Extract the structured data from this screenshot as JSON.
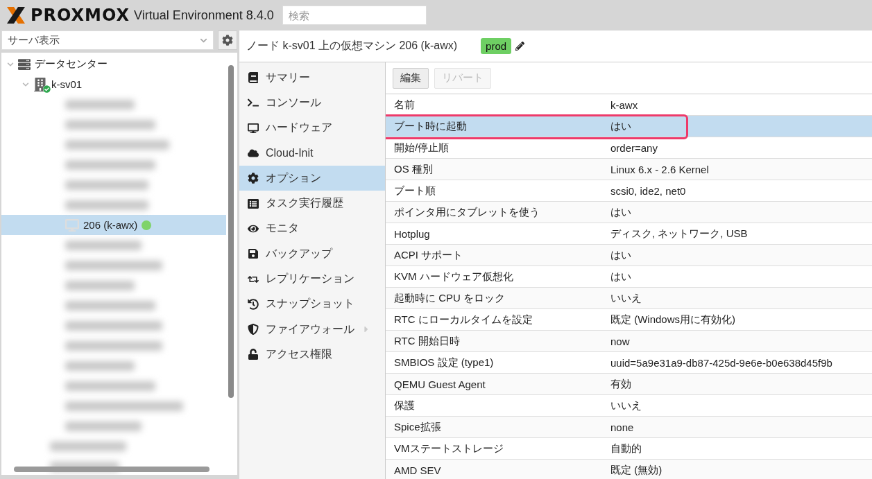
{
  "header": {
    "logo": "PROXMOX",
    "product": "Virtual Environment 8.4.0",
    "search": {
      "placeholder": "検索"
    }
  },
  "view_selector": {
    "value": "サーバ表示"
  },
  "tree": [
    {
      "kind": "datacenter",
      "label": "データセンター",
      "expanded": true,
      "children": [
        {
          "kind": "node",
          "label": "k-sv01",
          "expanded": true,
          "children": [
            {
              "kind": "blurred"
            },
            {
              "kind": "blurred"
            },
            {
              "kind": "blurred"
            },
            {
              "kind": "blurred"
            },
            {
              "kind": "blurred"
            },
            {
              "kind": "blurred"
            },
            {
              "kind": "vm",
              "label": "206 (k-awx)",
              "selected": true,
              "color": "#7fd36a"
            },
            {
              "kind": "blurred"
            },
            {
              "kind": "blurred"
            },
            {
              "kind": "blurred"
            },
            {
              "kind": "blurred"
            },
            {
              "kind": "blurred"
            },
            {
              "kind": "blurred"
            },
            {
              "kind": "blurred"
            },
            {
              "kind": "blurred"
            },
            {
              "kind": "blurred"
            },
            {
              "kind": "blurred"
            }
          ]
        },
        {
          "kind": "blurred"
        },
        {
          "kind": "blurred"
        }
      ]
    }
  ],
  "title": {
    "text_before": "ノード ",
    "node": "k-sv01",
    "text_middle": " 上の仮想マシン ",
    "vm": "206 (k-awx)",
    "tag": "prod"
  },
  "nav": [
    {
      "label": "サマリー",
      "selected": false
    },
    {
      "label": "コンソール",
      "selected": false
    },
    {
      "label": "ハードウェア",
      "selected": false
    },
    {
      "label": "Cloud-Init",
      "selected": false
    },
    {
      "label": "オプション",
      "selected": true
    },
    {
      "label": "タスク実行履歴",
      "selected": false
    },
    {
      "label": "モニタ",
      "selected": false
    },
    {
      "label": "バックアップ",
      "selected": false
    },
    {
      "label": "レプリケーション",
      "selected": false
    },
    {
      "label": "スナップショット",
      "selected": false
    },
    {
      "label": "ファイアウォール",
      "selected": false,
      "has_submenu": true
    },
    {
      "label": "アクセス権限",
      "selected": false
    }
  ],
  "toolbar": [
    {
      "label": "編集",
      "disabled": false
    },
    {
      "label": "リバート",
      "disabled": true
    }
  ],
  "options": [
    {
      "name": "名前",
      "value": "k-awx",
      "selected": false
    },
    {
      "name": "ブート時に起動",
      "value": "はい",
      "selected": true,
      "annotated": true
    },
    {
      "name": "開始/停止順",
      "value": "order=any",
      "selected": false
    },
    {
      "name": "OS 種別",
      "value": "Linux 6.x - 2.6 Kernel",
      "selected": false
    },
    {
      "name": "ブート順",
      "value": "scsi0, ide2, net0",
      "selected": false
    },
    {
      "name": "ポインタ用にタブレットを使う",
      "value": "はい",
      "selected": false
    },
    {
      "name": "Hotplug",
      "value": "ディスク, ネットワーク, USB",
      "selected": false
    },
    {
      "name": "ACPI サポート",
      "value": "はい",
      "selected": false
    },
    {
      "name": "KVM ハードウェア仮想化",
      "value": "はい",
      "selected": false
    },
    {
      "name": "起動時に CPU をロック",
      "value": "いいえ",
      "selected": false
    },
    {
      "name": "RTC にローカルタイムを設定",
      "value": "既定 (Windows用に有効化)",
      "selected": false
    },
    {
      "name": "RTC 開始日時",
      "value": "now",
      "selected": false
    },
    {
      "name": "SMBIOS 設定 (type1)",
      "value": "uuid=5a9e31a9-db87-425d-9e6e-b0e638d45f9b",
      "selected": false
    },
    {
      "name": "QEMU Guest Agent",
      "value": "有効",
      "selected": false
    },
    {
      "name": "保護",
      "value": "いいえ",
      "selected": false
    },
    {
      "name": "Spice拡張",
      "value": "none",
      "selected": false
    },
    {
      "name": "VMステートストレージ",
      "value": "自動的",
      "selected": false
    },
    {
      "name": "AMD SEV",
      "value": "既定 (無効)",
      "selected": false
    }
  ]
}
